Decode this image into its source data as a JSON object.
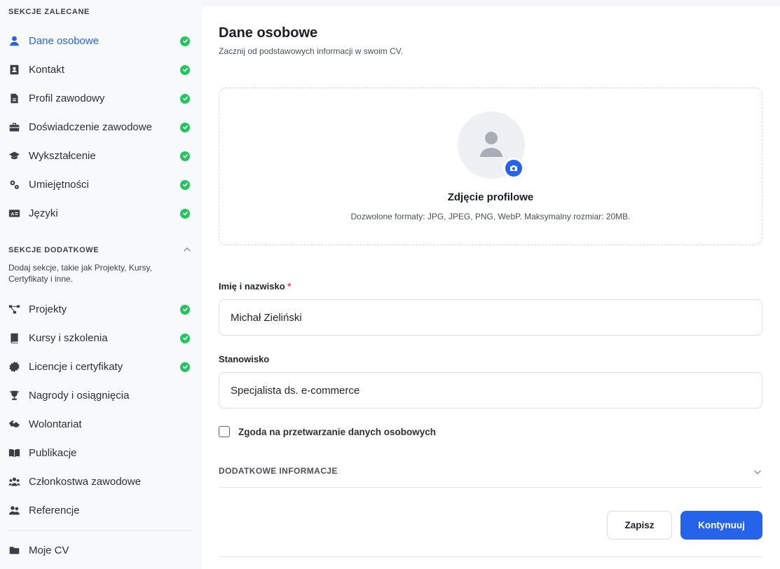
{
  "sidebar": {
    "recommended_title": "SEKCJE ZALECANE",
    "recommended": [
      {
        "label": "Dane osobowe",
        "icon": "user-icon",
        "done": true,
        "active": true
      },
      {
        "label": "Kontakt",
        "icon": "contact-card-icon",
        "done": true
      },
      {
        "label": "Profil zawodowy",
        "icon": "document-icon",
        "done": true
      },
      {
        "label": "Doświadczenie zawodowe",
        "icon": "briefcase-icon",
        "done": true
      },
      {
        "label": "Wykształcenie",
        "icon": "graduation-cap-icon",
        "done": true
      },
      {
        "label": "Umiejętności",
        "icon": "gears-icon",
        "done": true
      },
      {
        "label": "Języki",
        "icon": "language-icon",
        "done": true
      }
    ],
    "additional_title": "SEKCJE DODATKOWE",
    "additional_desc": "Dodaj sekcje, takie jak Projekty, Kursy, Certyfikaty i inne.",
    "additional": [
      {
        "label": "Projekty",
        "icon": "diagram-icon",
        "done": true
      },
      {
        "label": "Kursy i szkolenia",
        "icon": "book-icon",
        "done": true
      },
      {
        "label": "Licencje i certyfikaty",
        "icon": "certificate-icon",
        "done": true
      },
      {
        "label": "Nagrody i osiągnięcia",
        "icon": "trophy-icon",
        "done": false
      },
      {
        "label": "Wolontariat",
        "icon": "handshake-icon",
        "done": false
      },
      {
        "label": "Publikacje",
        "icon": "open-book-icon",
        "done": false
      },
      {
        "label": "Członkostwa zawodowe",
        "icon": "group-icon",
        "done": false
      },
      {
        "label": "Referencje",
        "icon": "people-icon",
        "done": false
      }
    ],
    "my_cv": {
      "label": "Moje CV",
      "icon": "folder-icon"
    }
  },
  "main": {
    "title": "Dane osobowe",
    "subtitle": "Zacznij od podstawowych informacji w swoim CV.",
    "photo": {
      "title": "Zdjęcie profilowe",
      "hint": "Dozwolone formaty: JPG, JPEG, PNG, WebP. Maksymalny rozmiar: 20MB."
    },
    "name_field": {
      "label": "Imię i nazwisko",
      "required_mark": "*",
      "value": "Michał Zieliński"
    },
    "position_field": {
      "label": "Stanowisko",
      "value": "Specjalista ds. e-commerce"
    },
    "consent_label": "Zgoda na przetwarzanie danych osobowych",
    "consent_checked": false,
    "more_info_label": "DODATKOWE INFORMACJE",
    "save_label": "Zapisz",
    "continue_label": "Kontynuuj"
  },
  "colors": {
    "accent": "#2563eb",
    "success": "#22c55e",
    "required": "#e5484d"
  }
}
